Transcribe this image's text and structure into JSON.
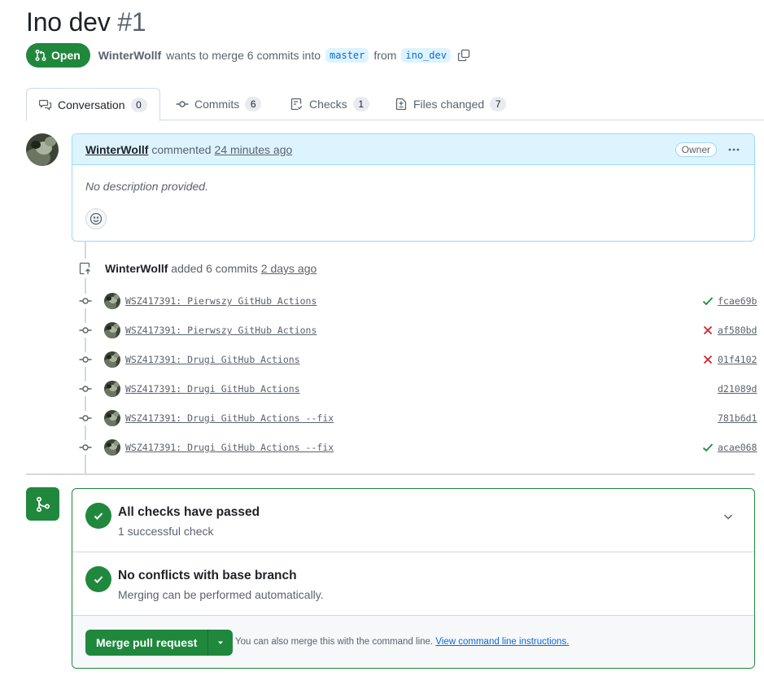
{
  "pr": {
    "title": "Ino dev",
    "number": "#1",
    "state": "Open",
    "author": "WinterWollf",
    "summary": "wants to merge 6 commits into",
    "base_branch": "master",
    "from_label": "from",
    "head_branch": "ino_dev"
  },
  "tabs": [
    {
      "label": "Conversation",
      "count": "0"
    },
    {
      "label": "Commits",
      "count": "6"
    },
    {
      "label": "Checks",
      "count": "1"
    },
    {
      "label": "Files changed",
      "count": "7"
    }
  ],
  "comment": {
    "author": "WinterWollf",
    "action": "commented",
    "time": "24 minutes ago",
    "role_badge": "Owner",
    "body": "No description provided."
  },
  "commit_event": {
    "author": "WinterWollf",
    "action": "added 6 commits",
    "time": "2 days ago"
  },
  "commits": [
    {
      "message": "WSZ417391: Pierwszy GitHub Actions",
      "status": "success",
      "sha": "fcae69b"
    },
    {
      "message": "WSZ417391: Pierwszy GitHub Actions",
      "status": "failure",
      "sha": "af580bd"
    },
    {
      "message": "WSZ417391: Drugi GitHub Actions",
      "status": "failure",
      "sha": "01f4102"
    },
    {
      "message": "WSZ417391: Drugi GitHub Actions",
      "status": "none",
      "sha": "d21089d"
    },
    {
      "message": "WSZ417391: Drugi GitHub Actions --fix",
      "status": "none",
      "sha": "781b6d1"
    },
    {
      "message": "WSZ417391: Drugi GitHub Actions --fix",
      "status": "success",
      "sha": "acae068"
    }
  ],
  "merge": {
    "checks_title": "All checks have passed",
    "checks_sub": "1 successful check",
    "conflicts_title": "No conflicts with base branch",
    "conflicts_sub": "Merging can be performed automatically.",
    "merge_button": "Merge pull request",
    "cli_text": "You can also merge this with the command line.",
    "cli_link": "View command line instructions."
  },
  "colors": {
    "success": "#1f883d",
    "failure": "#d1242f",
    "accent": "#0969da"
  }
}
